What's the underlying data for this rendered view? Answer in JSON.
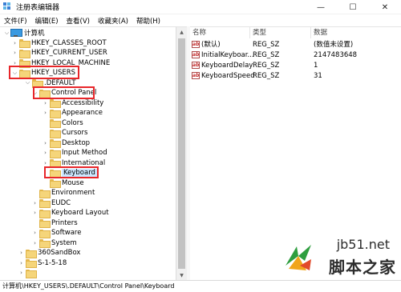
{
  "window": {
    "title": "注册表编辑器",
    "minimize": "—",
    "maximize": "☐",
    "close": "✕"
  },
  "menu": [
    "文件(F)",
    "编辑(E)",
    "查看(V)",
    "收藏夹(A)",
    "帮助(H)"
  ],
  "tree": {
    "root": "计算机",
    "classes_root": "HKEY_CLASSES_ROOT",
    "current_user": "HKEY_CURRENT_USER",
    "local_machine": "HKEY_LOCAL_MACHINE",
    "users": "HKEY_USERS",
    "default": ".DEFAULT",
    "control_panel": "Control Panel",
    "cp_children": [
      "Accessibility",
      "Appearance",
      "Colors",
      "Cursors",
      "Desktop",
      "Input Method",
      "International",
      "Keyboard",
      "Mouse"
    ],
    "default_children": [
      "Environment",
      "EUDC",
      "Keyboard Layout",
      "Printers",
      "Software",
      "System"
    ],
    "users_children": [
      "360SandBox",
      "S-1-5-18"
    ]
  },
  "list": {
    "headers": {
      "name": "名称",
      "type": "类型",
      "data": "数据"
    },
    "rows": [
      {
        "name": "(默认)",
        "type": "REG_SZ",
        "data": "(数值未设置)"
      },
      {
        "name": "InitialKeyboar...",
        "type": "REG_SZ",
        "data": "2147483648"
      },
      {
        "name": "KeyboardDelay",
        "type": "REG_SZ",
        "data": "1"
      },
      {
        "name": "KeyboardSpeed",
        "type": "REG_SZ",
        "data": "31"
      }
    ]
  },
  "status": {
    "path": "计算机\\HKEY_USERS\\.DEFAULT\\Control Panel\\Keyboard"
  },
  "watermark": {
    "site": "jb51.net",
    "text": "脚本之家"
  },
  "colors": {
    "highlight": "#e8262a",
    "selection": "#cce8ff",
    "folder": "#f5d57a"
  }
}
